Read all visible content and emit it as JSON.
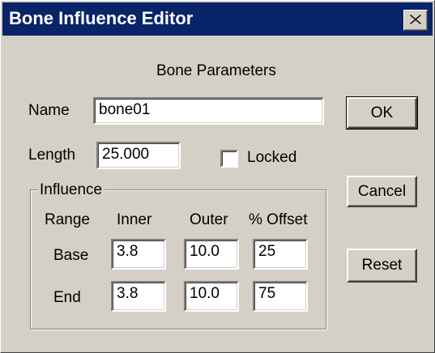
{
  "window": {
    "title": "Bone Influence Editor",
    "close_icon": "close-icon"
  },
  "dialog": {
    "section_heading": "Bone Parameters",
    "name_label": "Name",
    "name_value": "bone01",
    "length_label": "Length",
    "length_value": "25.000",
    "locked_label": "Locked",
    "locked_checked": false
  },
  "influence": {
    "group_label": "Influence",
    "columns": [
      "Range",
      "Inner",
      "Outer",
      "% Offset"
    ],
    "rows": [
      {
        "range": "Base",
        "inner": "3.8",
        "outer": "10.0",
        "offset": "25"
      },
      {
        "range": "End",
        "inner": "3.8",
        "outer": "10.0",
        "offset": "75"
      }
    ]
  },
  "buttons": {
    "ok": "OK",
    "cancel": "Cancel",
    "reset": "Reset"
  },
  "colors": {
    "titlebar": "#0a246a",
    "face": "#d4d0c8"
  }
}
